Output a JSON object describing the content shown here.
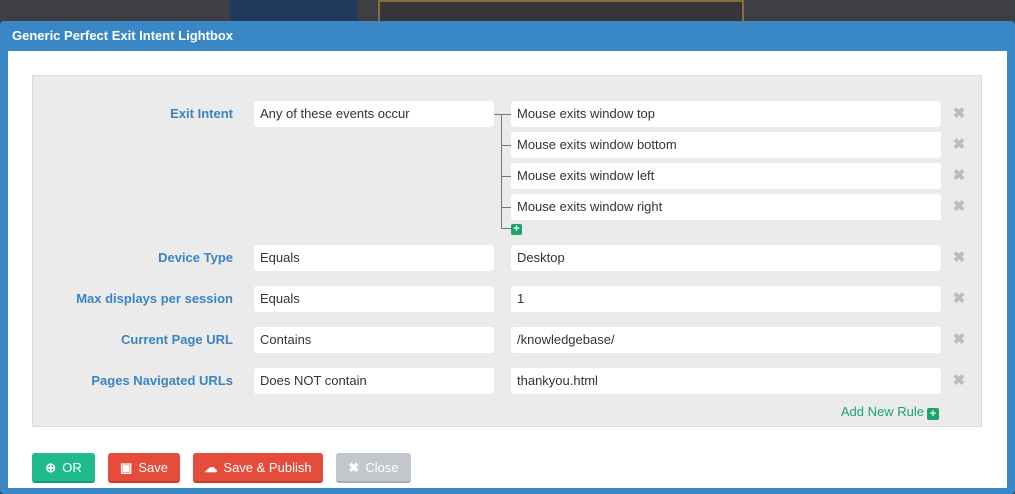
{
  "dialog": {
    "title": "Generic Perfect Exit Intent Lightbox"
  },
  "rules": {
    "exit_intent": {
      "label": "Exit Intent",
      "operator": "Any of these events occur",
      "values": [
        "Mouse exits window top",
        "Mouse exits window bottom",
        "Mouse exits window left",
        "Mouse exits window right"
      ]
    },
    "device_type": {
      "label": "Device Type",
      "operator": "Equals",
      "value": "Desktop"
    },
    "max_displays": {
      "label": "Max displays per session",
      "operator": "Equals",
      "value": "1"
    },
    "current_url": {
      "label": "Current Page URL",
      "operator": "Contains",
      "value": "/knowledgebase/"
    },
    "pages_navigated": {
      "label": "Pages Navigated URLs",
      "operator": "Does NOT contain",
      "value": "thankyou.html"
    },
    "remove_glyph": "✖",
    "add_new_rule": "Add New Rule"
  },
  "buttons": {
    "or": "OR",
    "save": "Save",
    "save_publish": "Save & Publish",
    "close": "Close"
  },
  "icons": {
    "or": "plus-circle-icon",
    "save": "floppy-disk-icon",
    "save_publish": "cloud-upload-icon",
    "close": "close-icon",
    "remove": "remove-x-icon",
    "add": "plus-square-icon"
  },
  "colors": {
    "accent_blue": "#3a87c5",
    "label_blue": "#3a84c4",
    "green": "#1fbb8d",
    "red": "#e64c3c",
    "gray_button": "#c3c6ca"
  }
}
